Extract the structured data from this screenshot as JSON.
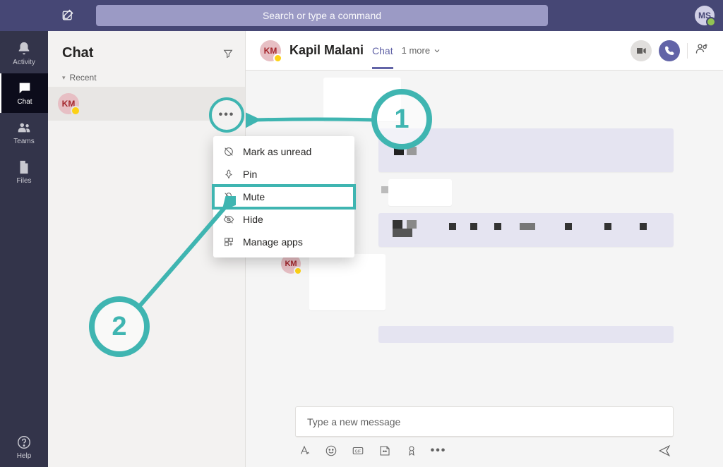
{
  "titlebar": {
    "search_placeholder": "Search or type a command",
    "me_initials": "MS"
  },
  "rail": {
    "items": [
      {
        "key": "activity",
        "label": "Activity"
      },
      {
        "key": "chat",
        "label": "Chat"
      },
      {
        "key": "teams",
        "label": "Teams"
      },
      {
        "key": "files",
        "label": "Files"
      }
    ],
    "help_label": "Help"
  },
  "listpane": {
    "title": "Chat",
    "recent_label": "Recent",
    "selected_initials": "KM"
  },
  "context_menu": {
    "items": [
      {
        "key": "unread",
        "label": "Mark as unread"
      },
      {
        "key": "pin",
        "label": "Pin"
      },
      {
        "key": "mute",
        "label": "Mute",
        "highlighted": true
      },
      {
        "key": "hide",
        "label": "Hide"
      },
      {
        "key": "apps",
        "label": "Manage apps"
      }
    ]
  },
  "chat_header": {
    "initials": "KM",
    "name": "Kapil Malani",
    "active_tab": "Chat",
    "more_text": "1 more"
  },
  "messages": {
    "sender_initials": "KM"
  },
  "compose": {
    "placeholder": "Type a new message"
  },
  "annotations": {
    "one": "1",
    "two": "2"
  }
}
